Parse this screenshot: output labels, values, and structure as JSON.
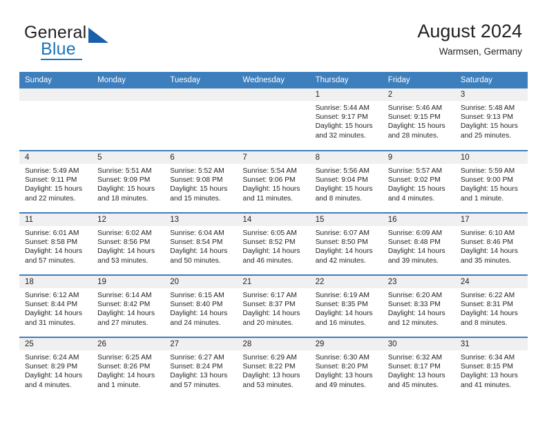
{
  "logo": {
    "line1": "General",
    "line2": "Blue",
    "brand_color": "#1b75bb"
  },
  "header": {
    "title": "August 2024",
    "subtitle": "Warmsen, Germany",
    "header_bar_color": "#3d7ebc"
  },
  "weekday_headers": [
    "Sunday",
    "Monday",
    "Tuesday",
    "Wednesday",
    "Thursday",
    "Friday",
    "Saturday"
  ],
  "weeks": [
    [
      {
        "day": "",
        "lines": []
      },
      {
        "day": "",
        "lines": []
      },
      {
        "day": "",
        "lines": []
      },
      {
        "day": "",
        "lines": []
      },
      {
        "day": "1",
        "lines": [
          "Sunrise: 5:44 AM",
          "Sunset: 9:17 PM",
          "Daylight: 15 hours",
          "and 32 minutes."
        ]
      },
      {
        "day": "2",
        "lines": [
          "Sunrise: 5:46 AM",
          "Sunset: 9:15 PM",
          "Daylight: 15 hours",
          "and 28 minutes."
        ]
      },
      {
        "day": "3",
        "lines": [
          "Sunrise: 5:48 AM",
          "Sunset: 9:13 PM",
          "Daylight: 15 hours",
          "and 25 minutes."
        ]
      }
    ],
    [
      {
        "day": "4",
        "lines": [
          "Sunrise: 5:49 AM",
          "Sunset: 9:11 PM",
          "Daylight: 15 hours",
          "and 22 minutes."
        ]
      },
      {
        "day": "5",
        "lines": [
          "Sunrise: 5:51 AM",
          "Sunset: 9:09 PM",
          "Daylight: 15 hours",
          "and 18 minutes."
        ]
      },
      {
        "day": "6",
        "lines": [
          "Sunrise: 5:52 AM",
          "Sunset: 9:08 PM",
          "Daylight: 15 hours",
          "and 15 minutes."
        ]
      },
      {
        "day": "7",
        "lines": [
          "Sunrise: 5:54 AM",
          "Sunset: 9:06 PM",
          "Daylight: 15 hours",
          "and 11 minutes."
        ]
      },
      {
        "day": "8",
        "lines": [
          "Sunrise: 5:56 AM",
          "Sunset: 9:04 PM",
          "Daylight: 15 hours",
          "and 8 minutes."
        ]
      },
      {
        "day": "9",
        "lines": [
          "Sunrise: 5:57 AM",
          "Sunset: 9:02 PM",
          "Daylight: 15 hours",
          "and 4 minutes."
        ]
      },
      {
        "day": "10",
        "lines": [
          "Sunrise: 5:59 AM",
          "Sunset: 9:00 PM",
          "Daylight: 15 hours",
          "and 1 minute."
        ]
      }
    ],
    [
      {
        "day": "11",
        "lines": [
          "Sunrise: 6:01 AM",
          "Sunset: 8:58 PM",
          "Daylight: 14 hours",
          "and 57 minutes."
        ]
      },
      {
        "day": "12",
        "lines": [
          "Sunrise: 6:02 AM",
          "Sunset: 8:56 PM",
          "Daylight: 14 hours",
          "and 53 minutes."
        ]
      },
      {
        "day": "13",
        "lines": [
          "Sunrise: 6:04 AM",
          "Sunset: 8:54 PM",
          "Daylight: 14 hours",
          "and 50 minutes."
        ]
      },
      {
        "day": "14",
        "lines": [
          "Sunrise: 6:05 AM",
          "Sunset: 8:52 PM",
          "Daylight: 14 hours",
          "and 46 minutes."
        ]
      },
      {
        "day": "15",
        "lines": [
          "Sunrise: 6:07 AM",
          "Sunset: 8:50 PM",
          "Daylight: 14 hours",
          "and 42 minutes."
        ]
      },
      {
        "day": "16",
        "lines": [
          "Sunrise: 6:09 AM",
          "Sunset: 8:48 PM",
          "Daylight: 14 hours",
          "and 39 minutes."
        ]
      },
      {
        "day": "17",
        "lines": [
          "Sunrise: 6:10 AM",
          "Sunset: 8:46 PM",
          "Daylight: 14 hours",
          "and 35 minutes."
        ]
      }
    ],
    [
      {
        "day": "18",
        "lines": [
          "Sunrise: 6:12 AM",
          "Sunset: 8:44 PM",
          "Daylight: 14 hours",
          "and 31 minutes."
        ]
      },
      {
        "day": "19",
        "lines": [
          "Sunrise: 6:14 AM",
          "Sunset: 8:42 PM",
          "Daylight: 14 hours",
          "and 27 minutes."
        ]
      },
      {
        "day": "20",
        "lines": [
          "Sunrise: 6:15 AM",
          "Sunset: 8:40 PM",
          "Daylight: 14 hours",
          "and 24 minutes."
        ]
      },
      {
        "day": "21",
        "lines": [
          "Sunrise: 6:17 AM",
          "Sunset: 8:37 PM",
          "Daylight: 14 hours",
          "and 20 minutes."
        ]
      },
      {
        "day": "22",
        "lines": [
          "Sunrise: 6:19 AM",
          "Sunset: 8:35 PM",
          "Daylight: 14 hours",
          "and 16 minutes."
        ]
      },
      {
        "day": "23",
        "lines": [
          "Sunrise: 6:20 AM",
          "Sunset: 8:33 PM",
          "Daylight: 14 hours",
          "and 12 minutes."
        ]
      },
      {
        "day": "24",
        "lines": [
          "Sunrise: 6:22 AM",
          "Sunset: 8:31 PM",
          "Daylight: 14 hours",
          "and 8 minutes."
        ]
      }
    ],
    [
      {
        "day": "25",
        "lines": [
          "Sunrise: 6:24 AM",
          "Sunset: 8:29 PM",
          "Daylight: 14 hours",
          "and 4 minutes."
        ]
      },
      {
        "day": "26",
        "lines": [
          "Sunrise: 6:25 AM",
          "Sunset: 8:26 PM",
          "Daylight: 14 hours",
          "and 1 minute."
        ]
      },
      {
        "day": "27",
        "lines": [
          "Sunrise: 6:27 AM",
          "Sunset: 8:24 PM",
          "Daylight: 13 hours",
          "and 57 minutes."
        ]
      },
      {
        "day": "28",
        "lines": [
          "Sunrise: 6:29 AM",
          "Sunset: 8:22 PM",
          "Daylight: 13 hours",
          "and 53 minutes."
        ]
      },
      {
        "day": "29",
        "lines": [
          "Sunrise: 6:30 AM",
          "Sunset: 8:20 PM",
          "Daylight: 13 hours",
          "and 49 minutes."
        ]
      },
      {
        "day": "30",
        "lines": [
          "Sunrise: 6:32 AM",
          "Sunset: 8:17 PM",
          "Daylight: 13 hours",
          "and 45 minutes."
        ]
      },
      {
        "day": "31",
        "lines": [
          "Sunrise: 6:34 AM",
          "Sunset: 8:15 PM",
          "Daylight: 13 hours",
          "and 41 minutes."
        ]
      }
    ]
  ]
}
